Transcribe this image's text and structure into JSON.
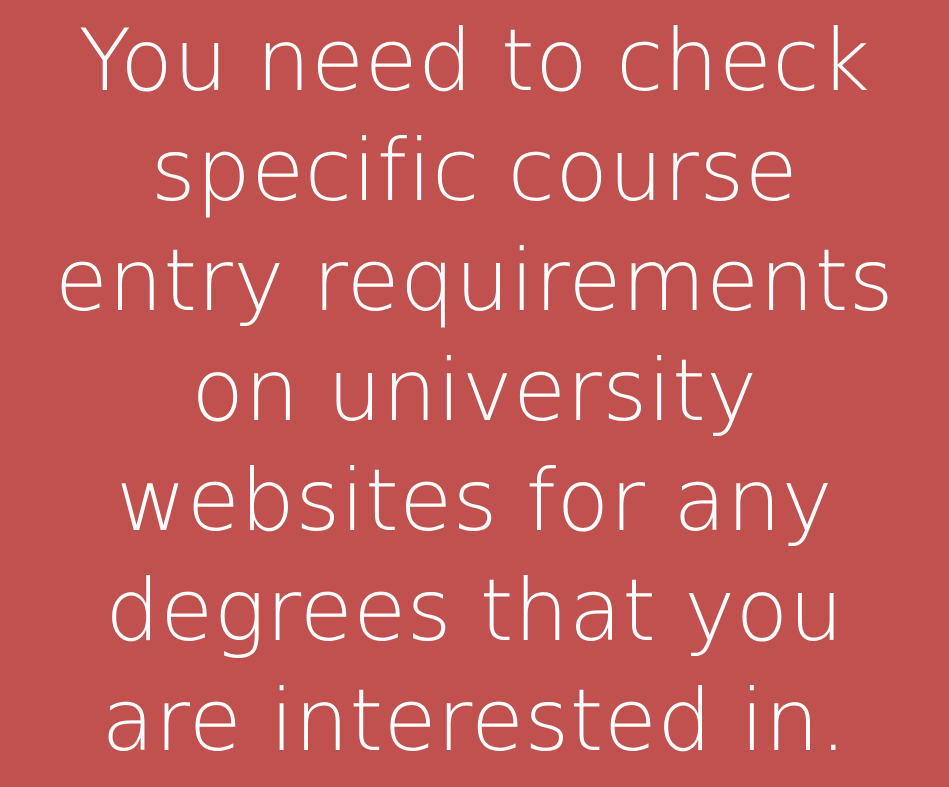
{
  "colors": {
    "background": "#c0514f",
    "text": "#ffffff"
  },
  "message": {
    "lines": [
      "You need to check",
      "specific course",
      "entry requirements",
      "on university",
      "websites for any",
      "degrees that you",
      "are interested in."
    ]
  }
}
